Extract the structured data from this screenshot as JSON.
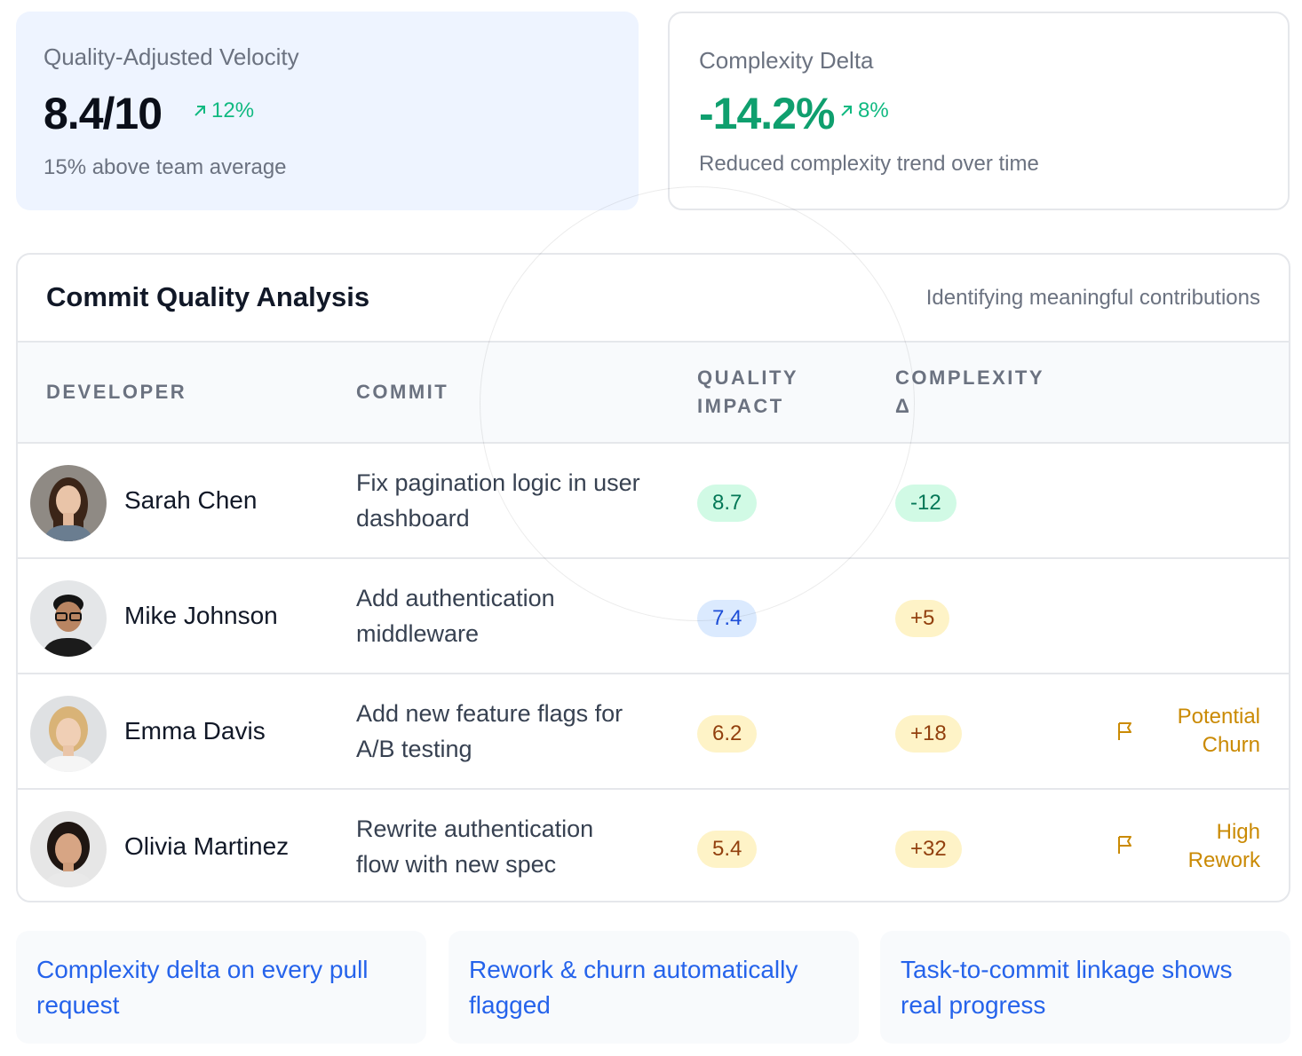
{
  "metrics": {
    "velocity": {
      "label": "Quality-Adjusted Velocity",
      "value": "8.4/10",
      "change": "12%",
      "subtext": "15% above team average"
    },
    "complexity": {
      "label": "Complexity Delta",
      "value": "-14.2%",
      "change": "8%",
      "subtext": "Reduced complexity trend over time"
    }
  },
  "table": {
    "title": "Commit Quality Analysis",
    "subtitle": "Identifying meaningful contributions",
    "headers": {
      "developer": "DEVELOPER",
      "commit": "COMMIT",
      "quality_1": "QUALITY",
      "quality_2": "IMPACT",
      "complexity_1": "COMPLEXITY",
      "complexity_2": "Δ"
    },
    "rows": [
      {
        "developer": "Sarah Chen",
        "commit": "Fix pagination logic in user dashboard",
        "quality": "8.7",
        "complexity": "-12",
        "flag_1": "",
        "flag_2": ""
      },
      {
        "developer": "Mike Johnson",
        "commit": "Add authentication middleware",
        "quality": "7.4",
        "complexity": "+5",
        "flag_1": "",
        "flag_2": ""
      },
      {
        "developer": "Emma Davis",
        "commit": "Add new feature flags for A/B testing",
        "quality": "6.2",
        "complexity": "+18",
        "flag_1": "Potential",
        "flag_2": "Churn"
      },
      {
        "developer": "Olivia Martinez",
        "commit": "Rewrite authentication flow with new spec",
        "quality": "5.4",
        "complexity": "+32",
        "flag_1": "High",
        "flag_2": "Rework"
      }
    ]
  },
  "features": [
    "Complexity delta on every pull request",
    "Rework & churn automatically flagged",
    "Task-to-commit linkage shows real progress"
  ],
  "colors": {
    "accent_blue": "#2563eb",
    "positive_green": "#10b981",
    "warning_amber": "#ca8a04"
  },
  "icons": {
    "trend": "arrow-up-right-icon",
    "flag": "flag-icon"
  }
}
